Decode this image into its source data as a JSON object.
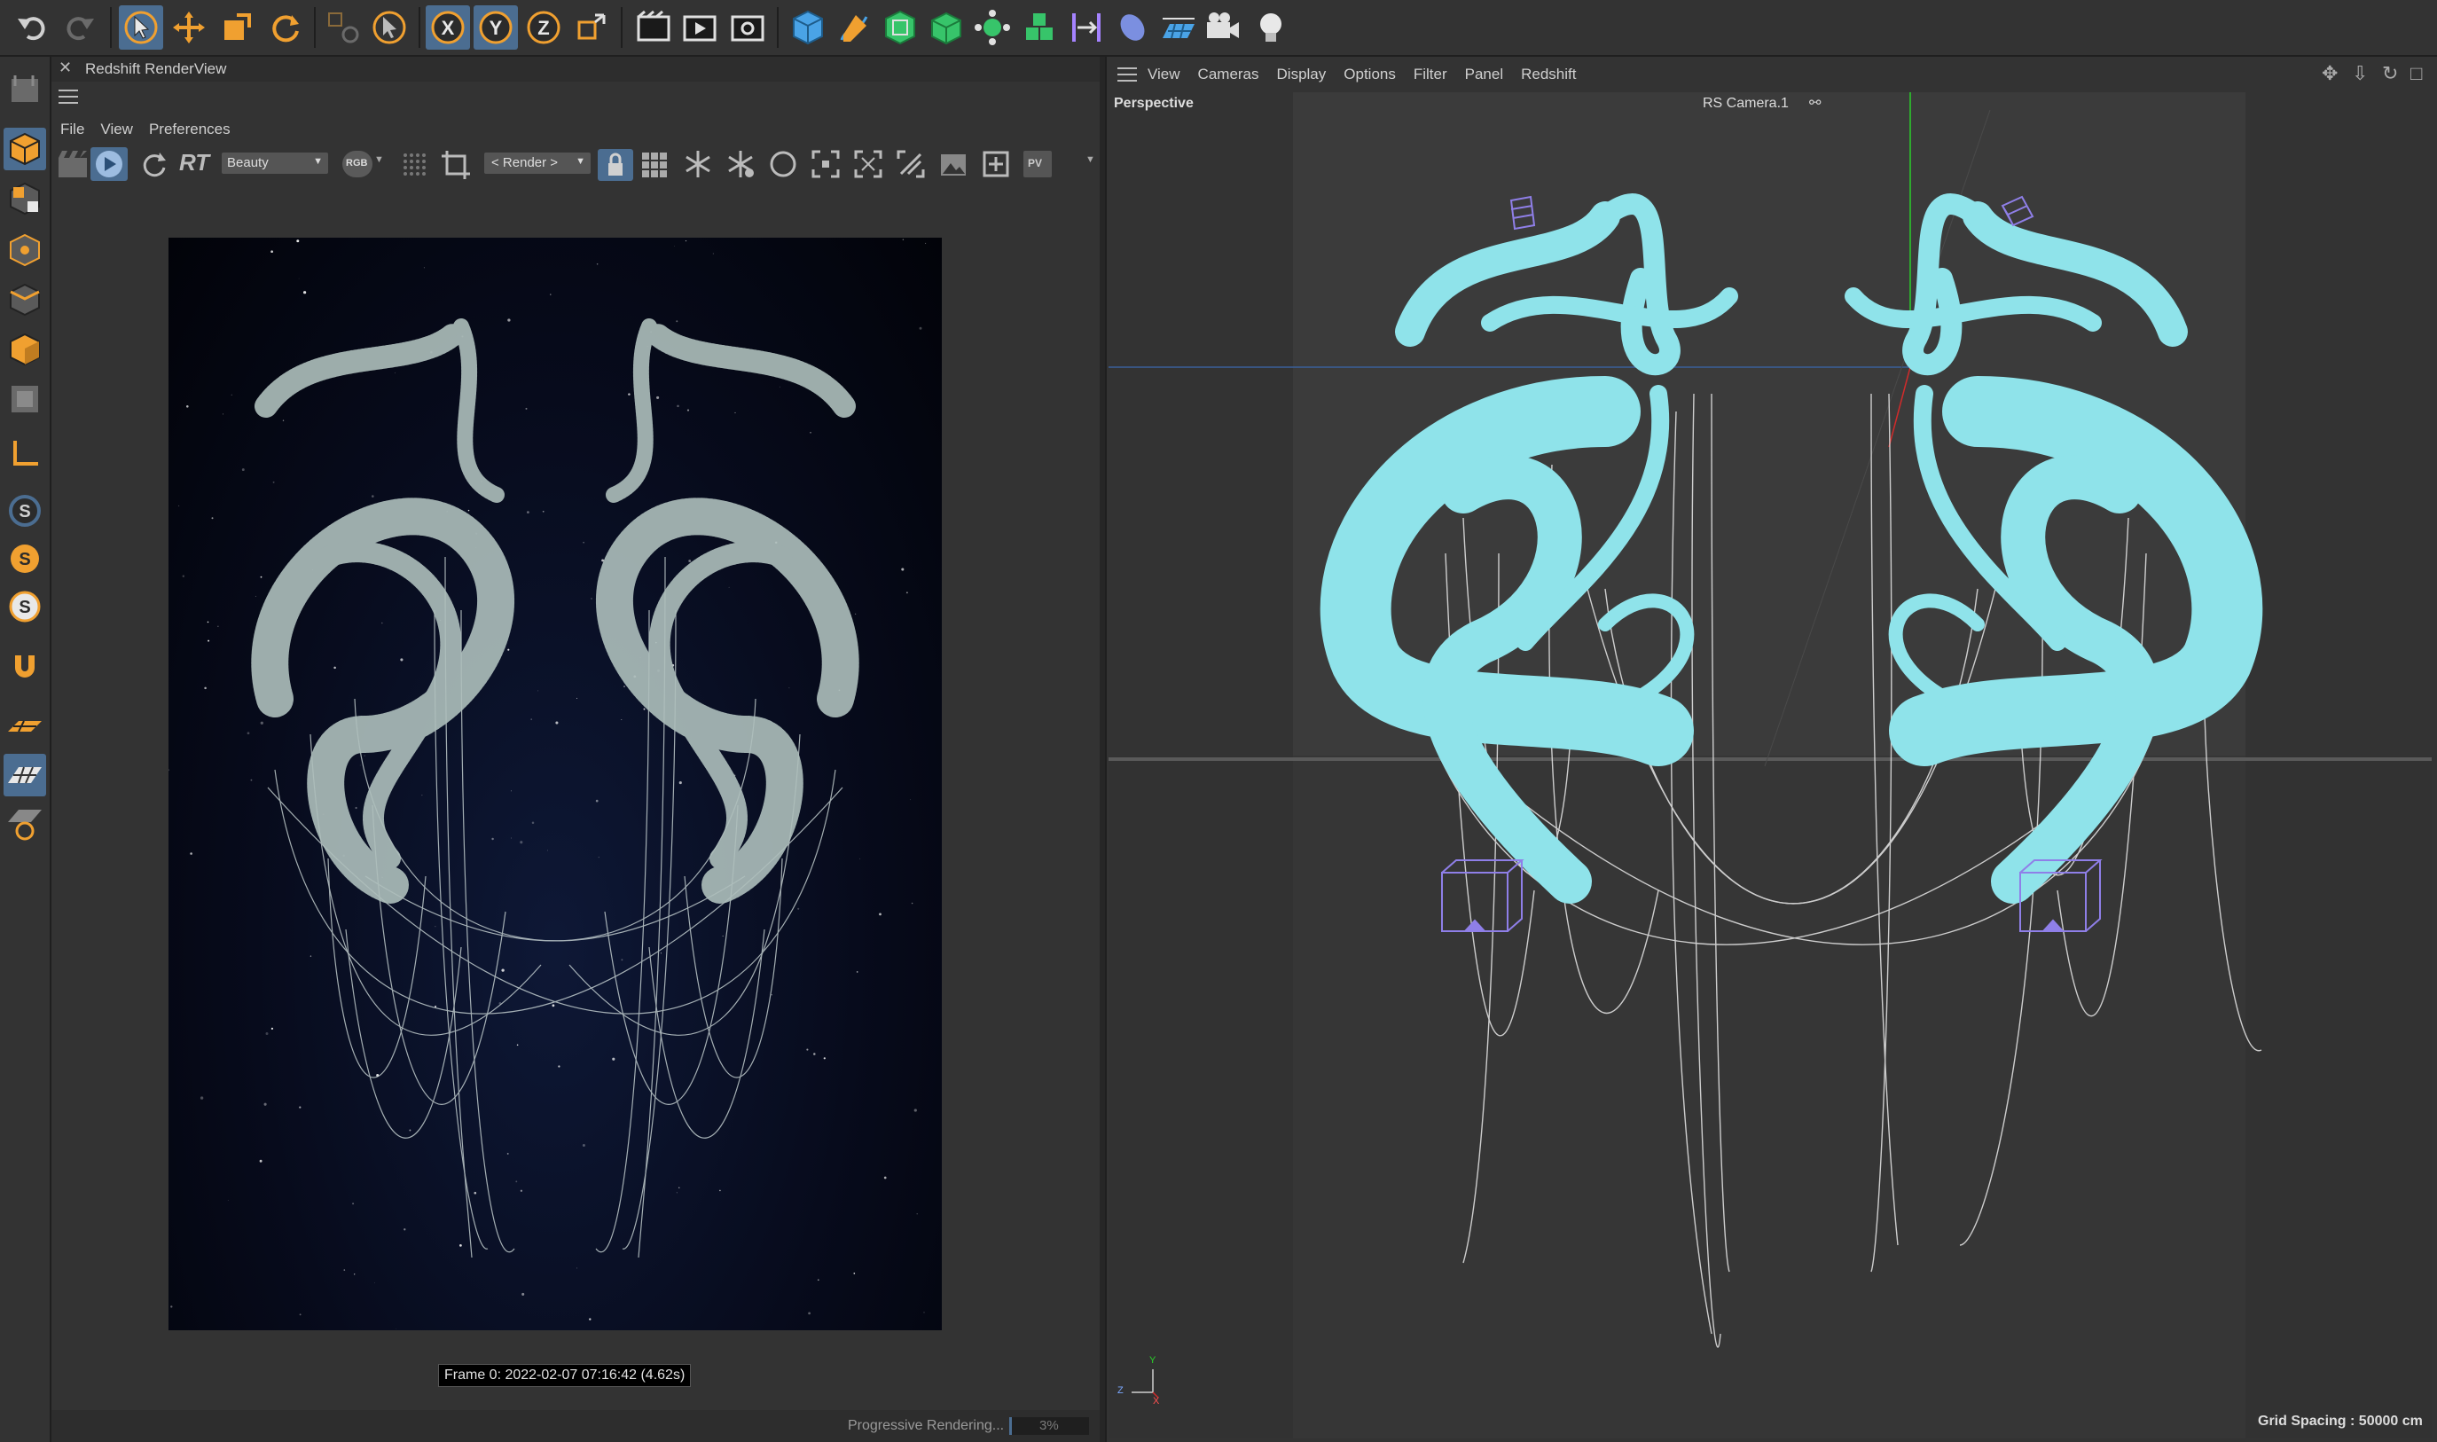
{
  "toolbar": {
    "buttons": [
      "undo-icon",
      "redo-icon",
      "select-icon",
      "move-icon",
      "scale-icon",
      "rotate-icon",
      "coordinate-icon",
      "live-select-icon",
      "x-axis-icon",
      "y-axis-icon",
      "z-axis-icon",
      "world-coords-icon",
      "render-region-icon",
      "render-view-icon",
      "render-settings-icon",
      "cube-icon",
      "pen-icon",
      "subdivide-icon",
      "extrude-icon",
      "cloner-icon",
      "array-icon",
      "deformer-icon",
      "field-icon",
      "floor-icon",
      "camera-icon",
      "light-icon"
    ],
    "axis_x": "X",
    "axis_y": "Y",
    "axis_z": "Z"
  },
  "render_view": {
    "title": "Redshift RenderView",
    "menu": [
      "File",
      "View",
      "Preferences"
    ],
    "rt_label": "RT",
    "aov_select": "Beauty",
    "rgb_label": "RGB",
    "camera_select": "< Render >",
    "pv_label": "PV",
    "frame_info": "Frame  0:  2022-02-07  07:16:42  (4.62s)",
    "status": "Progressive Rendering...",
    "progress_text": "3%",
    "progress": 0.03
  },
  "viewport": {
    "menu": [
      "View",
      "Cameras",
      "Display",
      "Options",
      "Filter",
      "Panel",
      "Redshift"
    ],
    "view_label": "Perspective",
    "camera_label": "RS Camera.1",
    "grid_spacing": "Grid Spacing : 50000 cm",
    "axis_y": "Y",
    "axis_z": "Z",
    "axis_x": "X"
  },
  "left_tools": [
    "model-mode-icon",
    "texture-mode-icon",
    "point-mode-icon",
    "edge-mode-icon",
    "polygon-mode-icon",
    "uv-mode-icon",
    "axis-mode-icon",
    "snap-icon",
    "snap-settings-icon",
    "quantize-icon",
    "magnet-icon",
    "workplane-icon",
    "grid-icon",
    "locked-workplane-icon"
  ],
  "colors": {
    "accent_orange": "#f0a030",
    "selection_blue": "#4b6d91",
    "tube_cyan": "#8fe3ea",
    "camera_violet": "#8f7fe8"
  }
}
